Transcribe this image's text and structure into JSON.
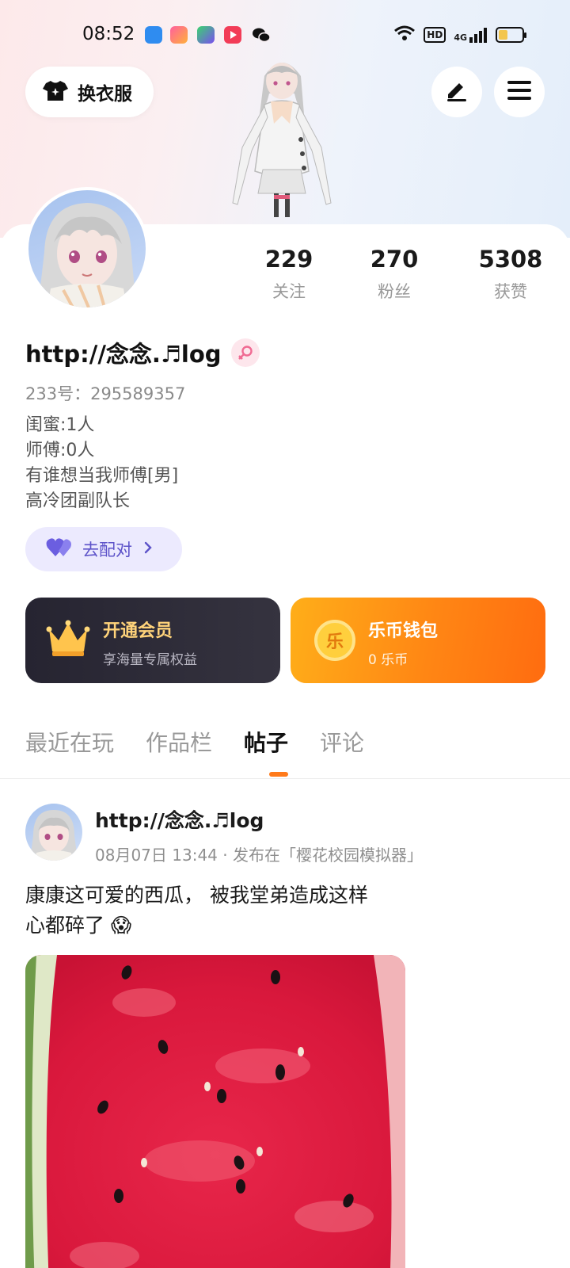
{
  "status_bar": {
    "time": "08:52",
    "network": "4G",
    "hd": "HD",
    "battery_level": 0.35,
    "app_icons": [
      "bluetooth-app-icon",
      "camera-app-icon",
      "video-app-icon",
      "player-app-icon",
      "wechat-icon"
    ]
  },
  "header": {
    "outfit_label": "换衣服",
    "icons": [
      "edit-icon",
      "menu-icon"
    ]
  },
  "profile": {
    "stats": [
      {
        "value": "229",
        "label": "关注"
      },
      {
        "value": "270",
        "label": "粉丝"
      },
      {
        "value": "5308",
        "label": "获赞"
      }
    ],
    "nickname": "http://念念.♬log",
    "gender": "female",
    "id_text": "233号：295589357",
    "bio_lines": [
      "闺蜜:1人",
      "师傅:0人",
      "有谁想当我师傅[男]",
      "高冷团副队长"
    ],
    "match_label": "去配对"
  },
  "vip": {
    "title": "开通会员",
    "subtitle": "享海量专属权益"
  },
  "wallet": {
    "title": "乐币钱包",
    "subtitle": "0 乐币",
    "coin_char": "乐"
  },
  "tabs": [
    {
      "label": "最近在玩",
      "active": false
    },
    {
      "label": "作品栏",
      "active": false
    },
    {
      "label": "帖子",
      "active": true
    },
    {
      "label": "评论",
      "active": false
    }
  ],
  "post": {
    "author": "http://念念.♬log",
    "meta": "08月07日 13:44 · 发布在「樱花校园模拟器」",
    "text_lines": [
      "康康这可爱的西瓜， 被我堂弟造成这样",
      "心都碎了 😱"
    ]
  },
  "colors": {
    "accent": "#ff7a1a",
    "match": "#5d53c9",
    "vip_gold": "#ffd37a",
    "wallet_orange": "#ff8614"
  }
}
